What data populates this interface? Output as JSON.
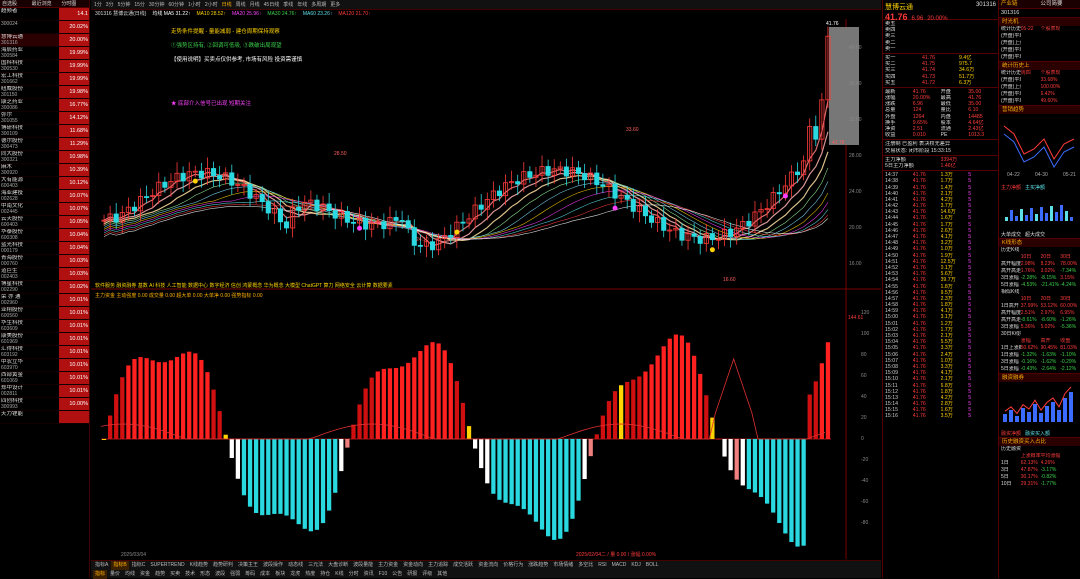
{
  "left_list": {
    "headers": [
      "自选股",
      "最近浏览",
      "分时图"
    ],
    "rows": [
      {
        "name": "超频者",
        "code": "",
        "pct": "14.1"
      },
      {
        "name": "",
        "code": "300024",
        "pct": "20.02%"
      },
      {
        "name": "慧博云通",
        "code": "301316",
        "pct": "20.00%"
      },
      {
        "name": "海辰药业",
        "code": "300584",
        "pct": "19.99%"
      },
      {
        "name": "国科科技",
        "code": "300530",
        "pct": "19.99%"
      },
      {
        "name": "宏工科技",
        "code": "301662",
        "pct": "19.99%"
      },
      {
        "name": "纽威股份",
        "code": "301150",
        "pct": "19.98%"
      },
      {
        "name": "康芝药业",
        "code": "300086",
        "pct": "16.77%"
      },
      {
        "name": "弥尔",
        "code": "301055",
        "pct": "14.12%"
      },
      {
        "name": "博研科技",
        "code": "300109",
        "pct": "11.68%"
      },
      {
        "name": "德尔股份",
        "code": "300473",
        "pct": "11.29%"
      },
      {
        "name": "同大股份",
        "code": "300321",
        "pct": "10.98%"
      },
      {
        "name": "麻木",
        "code": "300920",
        "pct": "10.39%"
      },
      {
        "name": "大有能源",
        "code": "600403",
        "pct": "10.12%"
      },
      {
        "name": "海亚建投",
        "code": "002628",
        "pct": "10.07%"
      },
      {
        "name": "中南文化",
        "code": "002445",
        "pct": "10.07%"
      },
      {
        "name": "云天股份",
        "code": "600403",
        "pct": "10.05%"
      },
      {
        "name": "华泰股份",
        "code": "600308",
        "pct": "10.04%"
      },
      {
        "name": "蓝光科技",
        "code": "000179",
        "pct": "10.04%"
      },
      {
        "name": "青海股份",
        "code": "000760",
        "pct": "10.03%"
      },
      {
        "name": "道巨生",
        "code": "002403",
        "pct": "10.03%"
      },
      {
        "name": "博星科技",
        "code": "002290",
        "pct": "10.02%"
      },
      {
        "name": "荣 亦 通",
        "code": "002960",
        "pct": "10.01%"
      },
      {
        "name": "亚翔股份",
        "code": "600560",
        "pct": "10.01%"
      },
      {
        "name": "华生科技",
        "code": "603609",
        "pct": "10.01%"
      },
      {
        "name": "康美股份",
        "code": "601969",
        "pct": "10.01%"
      },
      {
        "name": "汇得科技",
        "code": "603192",
        "pct": "10.01%"
      },
      {
        "name": "中农立华",
        "code": "603970",
        "pct": "10.01%"
      },
      {
        "name": "西部黄金",
        "code": "601069",
        "pct": "10.01%"
      },
      {
        "name": "郑中设计",
        "code": "002811",
        "pct": "10.01%"
      },
      {
        "name": "四创科技",
        "code": "300993",
        "pct": "10.00%"
      },
      {
        "name": "天力锂能",
        "code": "",
        "pct": ""
      }
    ]
  },
  "top_toolbar": [
    "1分",
    "3分",
    "5分钟",
    "15分",
    "30分钟",
    "60分钟",
    "1小时",
    "2小时",
    "日线",
    "周线",
    "月线",
    "45日线",
    "季线",
    "年线",
    "多周期",
    "更多"
  ],
  "ma_line": [
    {
      "text": "301316 慧博云通(日线)",
      "color": "#ddd"
    },
    {
      "text": "均线 MA5 31.22↑",
      "color": "#fff"
    },
    {
      "text": "MA10 28.52↑",
      "color": "#ffd200"
    },
    {
      "text": "MA20 25.96↑",
      "color": "#ff40ff"
    },
    {
      "text": "MA30 24.76↑",
      "color": "#3bd04a"
    },
    {
      "text": "MA60 23.26↑",
      "color": "#5de0e6"
    },
    {
      "text": "MA120 21.70↑",
      "color": "#ff3b3b"
    }
  ],
  "chart": {
    "pane1_notes": [
      {
        "text": "走势条件提醒 - 量能减弱 - 建仓周期保持观察",
        "color": "#ffd200"
      },
      {
        "text": "①强势区持有, ②回调可低吸, ③跌破出局观望",
        "color": "#3bd04a"
      },
      {
        "text": "【使用说明】买卖点仅供参考, 市场有风险 投资需谨慎",
        "color": "#ffffff"
      },
      {
        "text": "★ 底部介入信号已出现 短期关注",
        "color": "#ff40ff"
      }
    ],
    "price_labels": {
      "high": "41.76",
      "low": "16.60",
      "mid": "24.10",
      "p2": "33.60",
      "p3": "28.50"
    },
    "right_box_label": "41.76",
    "pane2_title": "主力资金  主动强度 0.00  成交量 0.00  超大单 0.00  大单净 0.00  强势指标 0.00",
    "pane2_value": "144.61",
    "date_label": "2025/03/04",
    "date_label2": "2025/02/04二 / 量 0.00 / 涨幅 0.00%",
    "pane1_scale": [
      "40.00",
      "36.00",
      "32.00",
      "28.00",
      "24.00",
      "20.00",
      "16.00"
    ],
    "pane2_scale": [
      "120",
      "100",
      "80",
      "60",
      "40",
      "20",
      "0",
      "-20",
      "-40",
      "-60",
      "-80"
    ],
    "scrolling_text": "软件服务 融资融券 基数 AI 科技 人工智能 数据中心 数字经济 信创 鸿蒙概念 华为概念 大模型 ChatGPT 算力 网络安全 云计算 数据要素"
  },
  "bottom_bar": {
    "row1": [
      "指标A",
      "指标B",
      "指标C",
      "SUPERTREND",
      "K线趋势",
      "趋势研判",
      "决策主王",
      "波段操作",
      "动态线",
      "三元法",
      "大盘诊断",
      "波段量能",
      "主力资金",
      "资金动向",
      "主力追踪",
      "成交活跃",
      "资金流向",
      "价格行为",
      "涨跌趋势",
      "市场情绪",
      "多空比",
      "RSI",
      "MACD",
      "KDJ",
      "BOLL"
    ],
    "row2": [
      "指标",
      "量价",
      "均线",
      "资金",
      "趋势",
      "买卖",
      "技术",
      "形态",
      "波段",
      "强弱",
      "筹码",
      "成本",
      "板块",
      "龙虎",
      "热度",
      "持仓",
      "K线",
      "分时",
      "资讯",
      "F10",
      "公告",
      "研报",
      "评级",
      "其他"
    ]
  },
  "right_panel": {
    "title": "慧博云通",
    "code": "301316",
    "price": "41.76",
    "change": "6.96",
    "change_pct": "20.00%",
    "sell_rows": [
      {
        "label": "卖五",
        "price": "",
        "vol": ""
      },
      {
        "label": "卖四",
        "price": "",
        "vol": ""
      },
      {
        "label": "卖三",
        "price": "",
        "vol": ""
      },
      {
        "label": "卖二",
        "price": "",
        "vol": ""
      },
      {
        "label": "卖一",
        "price": "",
        "vol": ""
      }
    ],
    "buy_rows": [
      {
        "label": "买一",
        "price": "41.76",
        "vol": "9.4亿"
      },
      {
        "label": "买二",
        "price": "41.75",
        "vol": "975.7"
      },
      {
        "label": "买三",
        "price": "41.74",
        "vol": "34.6万"
      },
      {
        "label": "买四",
        "price": "41.73",
        "vol": "51.7万"
      },
      {
        "label": "买五",
        "price": "41.72",
        "vol": "6.3万"
      }
    ],
    "stats": [
      [
        "最新",
        "41.76",
        "开盘",
        "35.00"
      ],
      [
        "涨幅",
        "20.00%",
        "最高",
        "41.76"
      ],
      [
        "涨跌",
        "6.96",
        "最低",
        "35.00"
      ],
      [
        "总量",
        "124",
        "量比",
        "6.10"
      ],
      [
        "外盘",
        "1264",
        "内盘",
        "14485"
      ],
      [
        "换手",
        "9.65%",
        "股本",
        "4.64亿"
      ],
      [
        "净资",
        "2.51",
        "流通",
        "2.43亿"
      ],
      [
        "收益",
        "0.010",
        "PE",
        "1013.3"
      ]
    ],
    "notes": [
      "注册制  已盈利  表决权无差异",
      "交易状态: 闭市阶段 15:33:15"
    ],
    "main_flow": [
      {
        "label": "主力净额",
        "value": "3394万"
      },
      {
        "label": "5日主力净额",
        "value": "1.46亿"
      }
    ],
    "ticks": [
      [
        "14:37",
        "41.76",
        "1.3万",
        "5"
      ],
      [
        "14:38",
        "41.76",
        "1.7万",
        "5"
      ],
      [
        "14:39",
        "41.76",
        "1.4万",
        "5"
      ],
      [
        "14:40",
        "41.76",
        "2.1万",
        "5"
      ],
      [
        "14:41",
        "41.76",
        "4.2万",
        "5"
      ],
      [
        "14:42",
        "41.76",
        "3.7万",
        "5"
      ],
      [
        "14:43",
        "41.76",
        "14.6万",
        "5"
      ],
      [
        "14:44",
        "41.76",
        "1.6万",
        "5"
      ],
      [
        "14:45",
        "41.76",
        "1.7万",
        "5"
      ],
      [
        "14:46",
        "41.76",
        "2.6万",
        "5"
      ],
      [
        "14:47",
        "41.76",
        "4.1万",
        "5"
      ],
      [
        "14:48",
        "41.76",
        "3.2万",
        "5"
      ],
      [
        "14:49",
        "41.76",
        "1.0万",
        "5"
      ],
      [
        "14:50",
        "41.76",
        "1.9万",
        "5"
      ],
      [
        "14:51",
        "41.76",
        "12.5万",
        "5"
      ],
      [
        "14:52",
        "41.76",
        "0.1万",
        "5"
      ],
      [
        "14:53",
        "41.76",
        "5.6万",
        "5"
      ],
      [
        "14:54",
        "41.76",
        "39.7万",
        "5"
      ],
      [
        "14:55",
        "41.76",
        "1.8万",
        "5"
      ],
      [
        "14:56",
        "41.76",
        "9.5万",
        "5"
      ],
      [
        "14:57",
        "41.76",
        "2.3万",
        "5"
      ],
      [
        "14:58",
        "41.76",
        "1.8万",
        "5"
      ],
      [
        "14:59",
        "41.76",
        "4.1万",
        "5"
      ],
      [
        "15:00",
        "41.76",
        "3.1万",
        "5"
      ],
      [
        "15:01",
        "41.76",
        "1.2万",
        "5"
      ],
      [
        "15:02",
        "41.76",
        "1.7万",
        "5"
      ],
      [
        "15:03",
        "41.76",
        "2.1万",
        "5"
      ],
      [
        "15:04",
        "41.76",
        "5.5万",
        "5"
      ],
      [
        "15:05",
        "41.76",
        "3.3万",
        "5"
      ],
      [
        "15:06",
        "41.76",
        "2.4万",
        "5"
      ],
      [
        "15:07",
        "41.76",
        "1.0万",
        "5"
      ],
      [
        "15:08",
        "41.76",
        "3.3万",
        "5"
      ],
      [
        "15:09",
        "41.76",
        "4.1万",
        "5"
      ],
      [
        "15:10",
        "41.76",
        "2.1万",
        "5"
      ],
      [
        "15:11",
        "41.76",
        "6.8万",
        "5"
      ],
      [
        "15:12",
        "41.76",
        "1.8万",
        "5"
      ],
      [
        "15:13",
        "41.76",
        "4.2万",
        "5"
      ],
      [
        "15:14",
        "41.76",
        "2.8万",
        "5"
      ],
      [
        "15:15",
        "41.76",
        "1.6万",
        "5"
      ],
      [
        "15:16",
        "41.76",
        "3.5万",
        "5"
      ]
    ]
  },
  "far_right": {
    "tabs": [
      "产业链",
      "公司简要"
    ],
    "code": "301316",
    "sections": [
      {
        "title": "时光机",
        "rows": [
          [
            "统计历史上",
            "05-22",
            "个股表现",
            ""
          ],
          [
            "(开盘)平均涨幅",
            "",
            "",
            ""
          ],
          [
            "(开盘)上涨概率",
            "",
            "",
            ""
          ],
          [
            "(开盘)平均涨幅",
            "",
            "",
            ""
          ],
          [
            "(开盘)平均振幅",
            "",
            "",
            ""
          ]
        ]
      },
      {
        "title": "统计历史上",
        "rows": [
          [
            "统计历史上",
            "周四",
            "个股表现",
            ""
          ],
          [
            "(开盘)平均涨幅",
            "",
            "33.68%",
            ""
          ],
          [
            "(开盘)上涨概率",
            "",
            "100.00%",
            ""
          ],
          [
            "(开盘)平均涨幅",
            "",
            "6.42%",
            ""
          ],
          [
            "(开盘)平均振幅",
            "",
            "49.60%",
            ""
          ]
        ]
      },
      {
        "title": "营销趋势",
        "rows": []
      },
      {
        "title": "K线形态",
        "rows": [
          [
            "历史K线",
            "",
            "",
            ""
          ],
          [
            "",
            "10日",
            "20日",
            "30日"
          ],
          [
            "高开幅度",
            "2.98%",
            "8.23%",
            "78.00%"
          ],
          [
            "高开高走",
            "1.76%",
            "3.02%",
            "-7.34%"
          ],
          [
            "3日涨幅",
            "-2.28%",
            "-8.15%",
            "3.15%"
          ],
          [
            "5日涨幅",
            "-4.53%",
            "-21.41%",
            "-4.24%"
          ]
        ]
      },
      {
        "title": "",
        "rows": [
          [
            "相似K线",
            "",
            "",
            ""
          ],
          [
            "",
            "10日",
            "20日",
            "30日"
          ],
          [
            "1日高开",
            "37.99%",
            "53.12%",
            "60.00%"
          ],
          [
            "高开幅度",
            "2.51%",
            "2.97%",
            "6.95%"
          ],
          [
            "高开高走",
            "-8.61%",
            "-8.60%",
            "-1.26%"
          ],
          [
            "3日涨幅",
            "5.36%",
            "5.02%",
            "-5.36%"
          ]
        ]
      },
      {
        "title": "",
        "rows": [
          [
            "30日K线相似个股",
            "",
            "",
            ""
          ],
          [
            "",
            "涨幅",
            "高开",
            "收盘"
          ],
          [
            "1日上涨概率",
            "50.62%",
            "90.45%",
            "81.03%"
          ],
          [
            "1日涨幅",
            "-1.32%",
            "-1.63%",
            "-1.10%"
          ],
          [
            "3日涨幅",
            "-0.16%",
            "-1.62%",
            "-0.29%"
          ],
          [
            "5日涨幅",
            "-0.43%",
            "-2.64%",
            "-2.12%"
          ]
        ]
      },
      {
        "title": "融资融券",
        "rows": []
      },
      {
        "title": "历史融资买入占比",
        "rows": [
          [
            "历史融资买入比处于13.2%附近时",
            "",
            "",
            ""
          ],
          [
            "",
            "上涨概率",
            "平均涨幅",
            ""
          ],
          [
            "1日",
            "62.13%",
            "4.26%",
            ""
          ],
          [
            "3日",
            "47.87%",
            "-3.17%",
            ""
          ],
          [
            "5日",
            "30.17%",
            "-0.82%",
            ""
          ],
          [
            "10日",
            "29.31%",
            "-1.77%",
            ""
          ]
        ]
      }
    ],
    "chart_dates": [
      "04-22",
      "04-30",
      "05-21"
    ],
    "legend1": [
      "主力净额",
      "主买净额"
    ],
    "legend2": [
      "大单成交",
      "超大成交"
    ],
    "legend3": [
      "融资净额",
      "融资买入额"
    ]
  },
  "colors": {
    "up": "#ff3b3b",
    "down": "#2ad9e0",
    "bg": "#000000",
    "accent": "#ffb000"
  }
}
